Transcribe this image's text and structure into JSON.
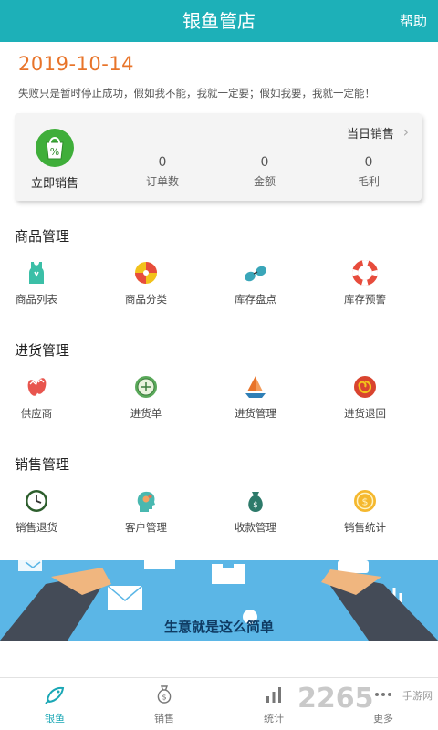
{
  "header": {
    "title": "银鱼管店",
    "help_label": "帮助"
  },
  "date": "2019-10-14",
  "motto": "失败只是暂时停止成功，假如我不能，我就一定要；假如我要，我就一定能！",
  "sales_card": {
    "action_label": "立即销售",
    "today_label": "当日销售",
    "stats": [
      {
        "value": "0",
        "label": "订单数"
      },
      {
        "value": "0",
        "label": "金额"
      },
      {
        "value": "0",
        "label": "毛利"
      }
    ]
  },
  "sections": [
    {
      "title": "商品管理",
      "items": [
        "商品列表",
        "商品分类",
        "库存盘点",
        "库存预警"
      ]
    },
    {
      "title": "进货管理",
      "items": [
        "供应商",
        "进货单",
        "进货管理",
        "进货退回"
      ]
    },
    {
      "title": "销售管理",
      "items": [
        "销售退货",
        "客户管理",
        "收款管理",
        "销售统计"
      ]
    }
  ],
  "banner": {
    "caption": "生意就是这么简单"
  },
  "tabbar": {
    "items": [
      "银鱼",
      "销售",
      "统计",
      "更多"
    ],
    "active": 0
  },
  "watermark": {
    "logo_text": "2265",
    "sub_text": "手游网"
  },
  "colors": {
    "accent": "#1db0b8",
    "date": "#e8742a",
    "banner": "#5bb6e6"
  },
  "icons": {
    "section_0": [
      "tanktop-icon",
      "beach-ball-icon",
      "sunglasses-icon",
      "lifebuoy-icon"
    ],
    "section_1": [
      "flip-flops-icon",
      "coin-icon",
      "sailboat-icon",
      "swirl-icon"
    ],
    "section_2": [
      "clock-icon",
      "head-gears-icon",
      "money-bag-icon",
      "gold-coin-icon"
    ]
  }
}
